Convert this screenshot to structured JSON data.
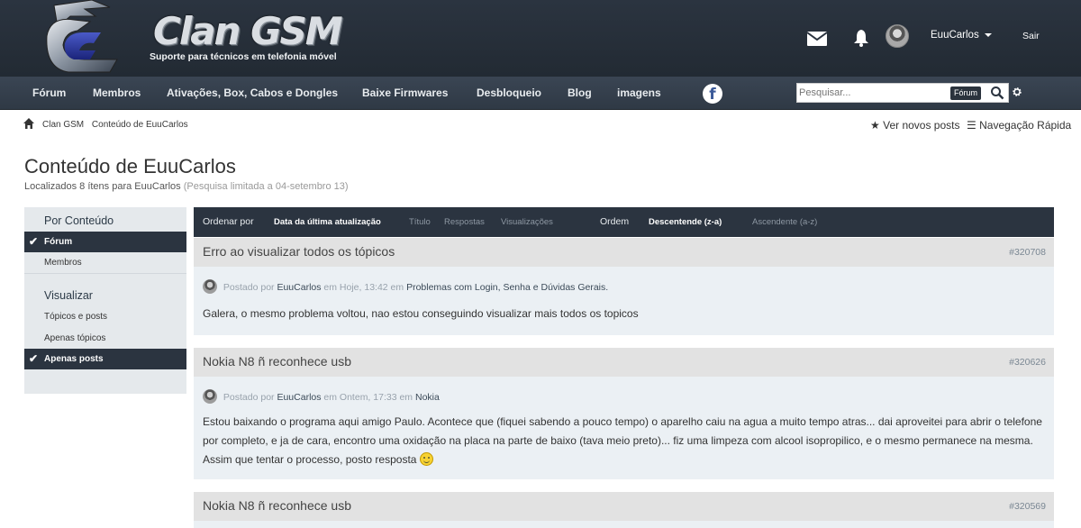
{
  "header": {
    "logo_title": "Clan GSM",
    "logo_subtitle": "Suporte para técnicos em telefonia móvel",
    "username": "EuuCarlos",
    "logout": "Sair",
    "icons": [
      "envelope-icon",
      "bell-icon"
    ]
  },
  "nav": {
    "items": [
      "Fórum",
      "Membros",
      "Ativações, Box, Cabos e Dongles",
      "Baixe Firmwares",
      "Desbloqueio",
      "Blog",
      "imagens"
    ],
    "facebook": "f",
    "search_placeholder": "Pesquisar...",
    "search_scope": "Fórum"
  },
  "breadcrumb": {
    "items": [
      "Clan GSM",
      "Conteúdo de EuuCarlos"
    ],
    "new_posts": "Ver novos posts",
    "quick_nav": "Navegação Rápida"
  },
  "page": {
    "title": "Conteúdo de EuuCarlos",
    "found": "Localizados 8 ítens para EuuCarlos",
    "limit": "(Pesquisa limitada a 04-setembro 13)"
  },
  "sidebar": {
    "group1": "Por Conteúdo",
    "group1_items": [
      "Fórum",
      "Membros"
    ],
    "group2": "Visualizar",
    "group2_items": [
      "Tópicos e posts",
      "Apenas tópicos",
      "Apenas posts"
    ]
  },
  "sort": {
    "order_by": "Ordenar por",
    "fields": [
      "Data da última atualização",
      "Título",
      "Respostas",
      "Visualizações"
    ],
    "order": "Ordem",
    "directions": [
      "Descentende (z-a)",
      "Ascendente (a-z)"
    ]
  },
  "results": [
    {
      "title": "Erro ao visualizar todos os tópicos",
      "id": "#320708",
      "posted_by": "Postado por",
      "author": "EuuCarlos",
      "when": "em Hoje, 13:42 em",
      "forum": "Problemas com Login, Senha e Dúvidas Gerais.",
      "body": "Galera, o mesmo problema voltou, nao estou conseguindo visualizar mais todos os topicos"
    },
    {
      "title": "Nokia N8 ñ reconhece usb",
      "id": "#320626",
      "posted_by": "Postado por",
      "author": "EuuCarlos",
      "when": "em Ontem, 17:33 em",
      "forum": "Nokia",
      "body": "Estou baixando o programa aqui amigo Paulo. Acontece que (fiquei sabendo a pouco tempo) o aparelho caiu na agua a muito tempo atras... dai aproveitei para abrir o telefone por completo, e ja de cara, encontro uma oxidação na placa na parte de baixo (tava meio preto)... fiz uma limpeza com alcool isopropilico, e o mesmo permanece na mesma. Assim que tentar o processo, posto resposta"
    },
    {
      "title": "Nokia N8 ñ reconhece usb",
      "id": "#320569"
    }
  ],
  "colors": {
    "header_bg": "#2b3440",
    "nav_bg": "#343f4b",
    "result_head": "#e2e2e2",
    "result_body": "#ebf0f4",
    "sidebar_bg": "#e5e9ec"
  }
}
